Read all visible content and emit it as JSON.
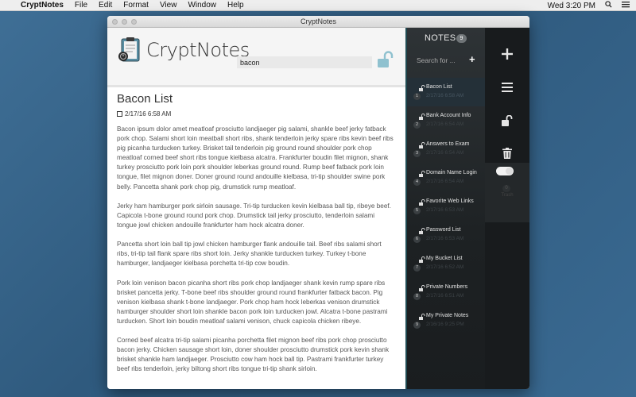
{
  "menubar": {
    "app": "CryptNotes",
    "items": [
      "File",
      "Edit",
      "Format",
      "View",
      "Window",
      "Help"
    ],
    "clock": "Wed 3:20 PM"
  },
  "window": {
    "title": "CryptNotes",
    "app_title": "CryptNotes",
    "search_value": "bacon"
  },
  "note": {
    "title": "Bacon List",
    "date": "2/17/16 6:58 AM",
    "paragraphs": [
      "Bacon ipsum dolor amet meatloaf prosciutto landjaeger pig salami, shankle beef jerky fatback pork chop. Salami short loin meatball short ribs, shank tenderloin jerky spare ribs kevin beef ribs pig picanha turducken turkey. Brisket tail tenderloin pig ground round shoulder pork chop meatloaf corned beef short ribs tongue kielbasa alcatra. Frankfurter boudin filet mignon, shank turkey prosciutto pork loin pork shoulder leberkas ground round. Rump beef fatback pork loin tongue, filet mignon doner. Doner ground round andouille kielbasa, tri-tip shoulder swine pork belly. Pancetta shank pork chop pig, drumstick rump meatloaf.",
      "Jerky ham hamburger pork sirloin sausage. Tri-tip turducken kevin kielbasa ball tip, ribeye beef. Capicola t-bone ground round pork chop. Drumstick tail jerky prosciutto, tenderloin salami tongue jowl chicken andouille frankfurter ham hock alcatra doner.",
      "Pancetta short loin ball tip jowl chicken hamburger flank andouille tail. Beef ribs salami short ribs, tri-tip tail flank spare ribs short loin. Jerky shankle turducken turkey. Turkey t-bone hamburger, landjaeger kielbasa porchetta tri-tip cow boudin.",
      "Pork loin venison bacon picanha short ribs pork chop landjaeger shank kevin rump spare ribs brisket pancetta jerky. T-bone beef ribs shoulder ground round frankfurter fatback bacon. Pig venison kielbasa shank t-bone landjaeger. Pork chop ham hock leberkas venison drumstick hamburger shoulder short loin shankle bacon pork loin turducken jowl. Alcatra t-bone pastrami turducken. Short loin boudin meatloaf salami venison, chuck capicola chicken ribeye.",
      "Corned beef alcatra tri-tip salami picanha porchetta filet mignon beef ribs pork chop prosciutto bacon jerky. Chicken sausage short loin, doner shoulder prosciutto drumstick pork kevin shank brisket shankle ham landjaeger. Prosciutto cow ham hock ball tip. Pastrami frankfurter turkey beef ribs tenderloin, jerky biltong short ribs tongue tri-tip shank sirloin."
    ]
  },
  "notes_panel": {
    "heading": "NOTES",
    "count": "9",
    "search_placeholder": "Search for ...",
    "add_label": "+",
    "items": [
      {
        "num": "1",
        "title": "Bacon List",
        "date": "2/17/16 6:58 AM"
      },
      {
        "num": "2",
        "title": "Bank Account Info",
        "date": "2/17/16 6:54 AM"
      },
      {
        "num": "3",
        "title": "Answers to Exam",
        "date": "2/17/16 6:54 AM"
      },
      {
        "num": "4",
        "title": "Domain Name Login",
        "date": "2/17/16 6:54 AM"
      },
      {
        "num": "5",
        "title": "Favorite Web Links",
        "date": "2/17/16 6:53 AM"
      },
      {
        "num": "6",
        "title": "Password List",
        "date": "2/17/16 6:53 AM"
      },
      {
        "num": "7",
        "title": "My Bucket List",
        "date": "2/17/16 6:52 AM"
      },
      {
        "num": "8",
        "title": "Private Numbers",
        "date": "2/17/16 6:51 AM"
      },
      {
        "num": "9",
        "title": "My Private Notes",
        "date": "2/16/16 9:25 PM"
      }
    ]
  },
  "toolbar": {
    "trash_count": "0",
    "trash_label": "Trash",
    "icons": [
      "plus-icon",
      "menu-icon",
      "unlock-icon",
      "trash-icon"
    ]
  },
  "colors": {
    "desktop": "#3a6a92",
    "sidebar": "#1d2123",
    "accent_lock": "#8fc1cf"
  }
}
